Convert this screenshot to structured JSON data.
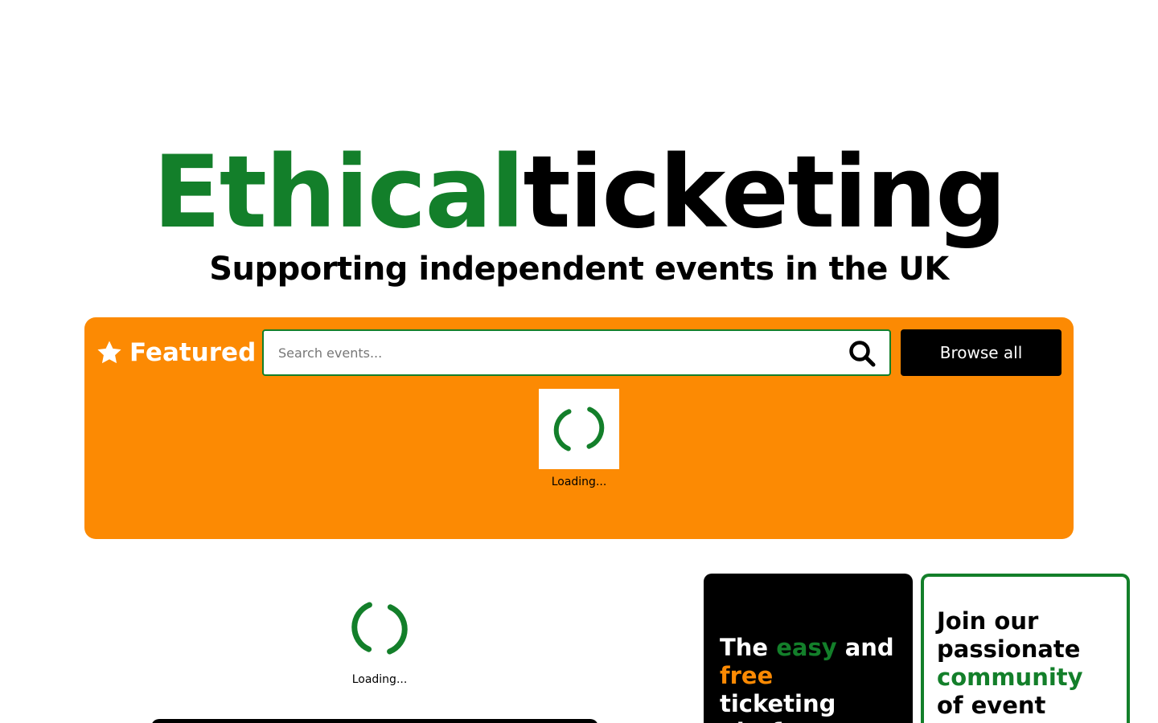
{
  "hero": {
    "title_part1": "Ethical",
    "title_part2": "ticketing",
    "subtitle": "Supporting independent events in the UK"
  },
  "featured": {
    "label": "Featured",
    "icon": "star-icon",
    "search": {
      "placeholder": "Search events...",
      "value": "",
      "icon": "search-icon"
    },
    "browse_label": "Browse all",
    "loading_text": "Loading..."
  },
  "lower": {
    "loading_text": "Loading..."
  },
  "promo_cards": [
    {
      "parts": [
        "The ",
        "easy",
        " and ",
        "free",
        " ticketing platform"
      ]
    },
    {
      "parts": [
        "Join our passionate ",
        "community",
        " of event"
      ]
    }
  ],
  "colors": {
    "brand_green": "#137f2a",
    "brand_orange": "#fc8a03",
    "black": "#000000",
    "white": "#ffffff"
  }
}
